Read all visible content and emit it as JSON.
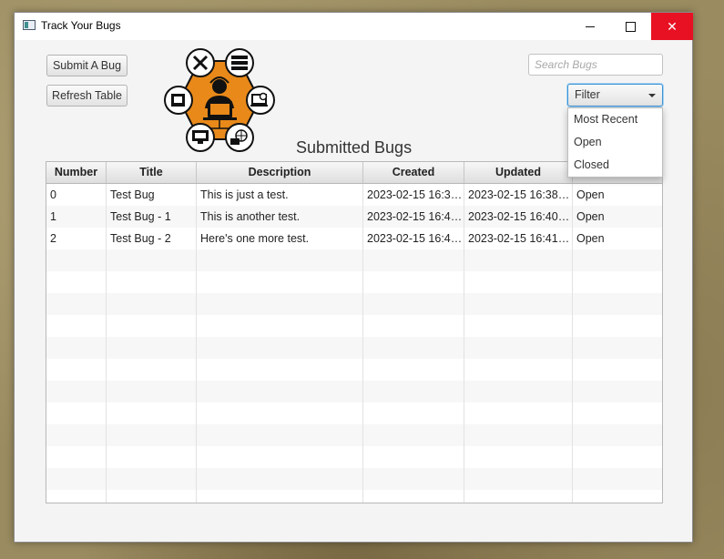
{
  "window": {
    "title": "Track Your Bugs",
    "close_glyph": "✕"
  },
  "toolbar": {
    "submit_label": "Submit A Bug",
    "refresh_label": "Refresh Table"
  },
  "heading": "Submitted Bugs",
  "search": {
    "placeholder": "Search Bugs",
    "value": ""
  },
  "filter": {
    "selected": "Filter",
    "options": [
      "Most Recent",
      "Open",
      "Closed"
    ]
  },
  "logo": {
    "icon": "developer-network-logo",
    "accent": "#e8891a"
  },
  "table": {
    "columns": [
      "Number",
      "Title",
      "Description",
      "Created",
      "Updated",
      "Status"
    ],
    "rows": [
      [
        "0",
        "Test Bug",
        "This is just a test.",
        "2023-02-15 16:38...",
        "2023-02-15 16:38:2...",
        "Open"
      ],
      [
        "1",
        "Test Bug - 1",
        "This is another test.",
        "2023-02-15 16:40...",
        "2023-02-15 16:40:5...",
        "Open"
      ],
      [
        "2",
        "Test Bug - 2",
        "Here's one more test.",
        "2023-02-15 16:41...",
        "2023-02-15 16:41:3...",
        "Open"
      ]
    ]
  },
  "colors": {
    "close_button": "#e81123",
    "focus_ring": "#3b93d6"
  }
}
